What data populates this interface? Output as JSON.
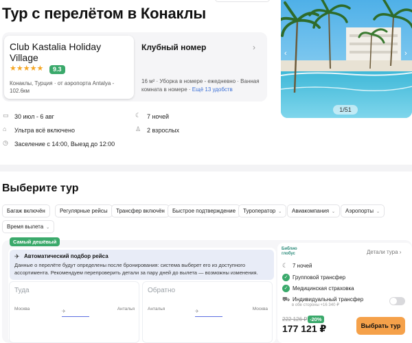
{
  "page": {
    "title": "Тур с перелётом в Конаклы"
  },
  "hotel": {
    "name": "Club Kastalia Holiday Village",
    "stars": "★★★★★",
    "rating": "9.3",
    "location": "Конаклы, Турция · от аэропорта Antalya - 102.6км"
  },
  "room": {
    "title": "Клубный номер",
    "chevron": "›",
    "desc": "16 м² · Уборка в номере - ежедневно · Ванная комната в номере ·",
    "more": "Ещё 13 удобств"
  },
  "photo": {
    "counter": "1/51",
    "prev": "‹",
    "next": "›"
  },
  "trip": {
    "dates": "30 июл - 6 авг",
    "meal": "Ультра всё включено",
    "checkin": "Заселение с 14:00, Выезд до 12:00",
    "nights": "7 ночей",
    "guests": "2 взрослых"
  },
  "choose": {
    "title": "Выберите тур"
  },
  "filters": {
    "row1": [
      "Багаж включён",
      "Регулярные рейсы",
      "Трансфер включён",
      "Быстрое подтверждение"
    ],
    "dropdowns": [
      "Туроператор",
      "Авиакомпания",
      "Аэропорты",
      "Время вылета"
    ]
  },
  "offer": {
    "badge": "Самый дешёвый",
    "auto_title": "Автоматический подбор рейса",
    "auto_text": "Данные о перелёте будут определены после бронирования: система выберет его из доступного ассортимента. Рекомендуем перепроверить детали за пару дней до вылета — возможны изменения.",
    "outbound": {
      "title": "Туда",
      "from": "Москва",
      "to": "Анталья"
    },
    "inbound": {
      "title": "Обратно",
      "from": "Анталья",
      "to": "Москва"
    },
    "operator_logo": [
      "Библио",
      "глобус"
    ],
    "details": "Детали тура",
    "nights": "7 ночей",
    "transfer": "Групповой трансфер",
    "insurance": "Медицинская страховка",
    "private_transfer": "Индивидуальный трансфер",
    "private_transfer_sub": "в обе стороны +16 340 ₽",
    "private_transfer_on": false,
    "old_price": "222 126 ₽",
    "discount": "-20%",
    "price": "177 121 ₽",
    "book": "Выбрать тур"
  },
  "colors": {
    "accent_green": "#3aa96b",
    "cta_orange": "#f5a14a",
    "link_blue": "#3b6fd6"
  }
}
